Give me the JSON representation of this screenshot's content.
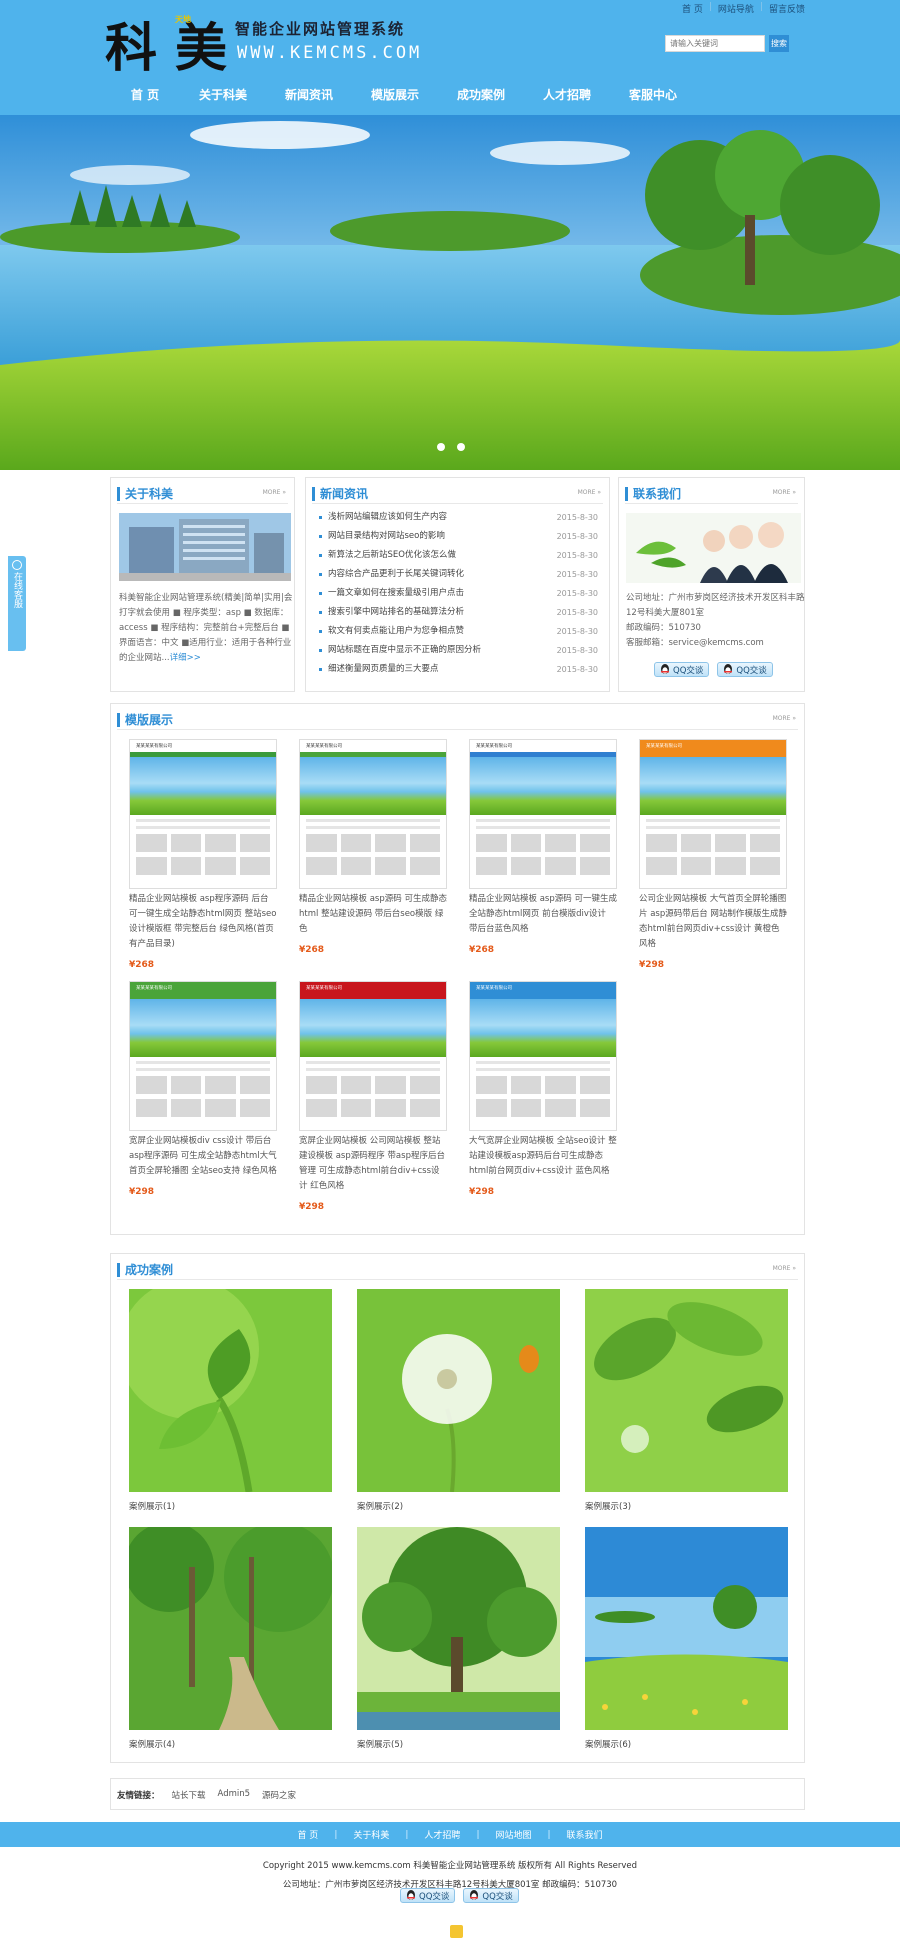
{
  "header": {
    "logo_main": "科美",
    "logo_badge": "天地",
    "logo_tagline": "智能企业网站管理系统",
    "logo_url": "WWW.KEMCMS.COM",
    "top_links": [
      "首 页",
      "网站导航",
      "留言反馈"
    ],
    "search_placeholder": "请输入关键词",
    "search_button": "搜索"
  },
  "nav": [
    "首 页",
    "关于科美",
    "新闻资讯",
    "模版展示",
    "成功案例",
    "人才招聘",
    "客服中心"
  ],
  "about": {
    "title": "关于科美",
    "more": "MORE »",
    "text": "科美智能企业网站管理系统(精美|简单|实用|会打字就会使用 ■ 程序类型：asp ■ 数据库：access ■ 程序结构：完整前台+完整后台 ■ 界面语言：中文 ■适用行业：适用于各种行业的企业网站...",
    "detail": "详细>>"
  },
  "news": {
    "title": "新闻资讯",
    "more": "MORE »",
    "items": [
      {
        "title": "浅析网站编辑应该如何生产内容",
        "date": "2015-8-30"
      },
      {
        "title": "网站目录结构对网站seo的影响",
        "date": "2015-8-30"
      },
      {
        "title": "新算法之后新站SEO优化该怎么做",
        "date": "2015-8-30"
      },
      {
        "title": "内容综合产品更利于长尾关键词转化",
        "date": "2015-8-30"
      },
      {
        "title": "一篇文章如何在搜索量级引用户点击",
        "date": "2015-8-30"
      },
      {
        "title": "搜索引擎中网站排名的基础算法分析",
        "date": "2015-8-30"
      },
      {
        "title": "软文有何卖点能让用户为您争相点赞",
        "date": "2015-8-30"
      },
      {
        "title": "网站标题在百度中显示不正确的原因分析",
        "date": "2015-8-30"
      },
      {
        "title": "细述衡量网页质量的三大要点",
        "date": "2015-8-30"
      }
    ]
  },
  "contact": {
    "title": "联系我们",
    "more": "MORE »",
    "address": "公司地址：广州市萝岗区经济技术开发区科丰路12号科美大厦801室",
    "postcode": "邮政编码：510730",
    "email": "客服邮箱：service@kemcms.com",
    "qq_buttons": [
      "QQ交谈",
      "QQ交谈"
    ]
  },
  "templates": {
    "title": "模版展示",
    "more": "MORE »",
    "shot_header": "某某某某有限公司",
    "items": [
      {
        "desc": "精品企业网站模板 asp程序源码 后台 可一键生成全站静态html网页 整站seo设计模版框 带完整后台 绿色风格(首页有产品目录)",
        "price": "¥268",
        "header": "#ffffff",
        "accent": "#3b9b3b"
      },
      {
        "desc": "精品企业网站模板 asp源码 可生成静态html 整站建设源码 带后台seo模版 绿色",
        "price": "¥268",
        "header": "#ffffff",
        "accent": "#4aa43a"
      },
      {
        "desc": "精品企业网站模板 asp源码 可一键生成全站静态html网页 前台模版div设计 带后台蓝色风格",
        "price": "¥268",
        "header": "#ffffff",
        "accent": "#2f7fd0"
      },
      {
        "desc": "公司企业网站模板 大气首页全屏轮播图片 asp源码带后台 网站制作模版生成静态html前台网页div+css设计 黄橙色风格",
        "price": "¥298",
        "header": "#f08a1c",
        "accent": "#f08a1c"
      },
      {
        "desc": "宽屏企业网站模板div css设计 带后台asp程序源码 可生成全站静态html大气首页全屏轮播图 全站seo支持 绿色风格",
        "price": "¥298",
        "header": "#4aa43a",
        "accent": "#4aa43a"
      },
      {
        "desc": "宽屏企业网站模板 公司网站模板 整站建设模板 asp源码程序 带asp程序后台管理 可生成静态html前台div+css设计 红色风格",
        "price": "¥298",
        "header": "#c8161d",
        "accent": "#c8161d"
      },
      {
        "desc": "大气宽屏企业网站模板 全站seo设计 整站建设模板asp源码后台可生成静态html前台网页div+css设计 蓝色风格",
        "price": "¥298",
        "header": "#2f8ed5",
        "accent": "#2f8ed5"
      }
    ]
  },
  "cases": {
    "title": "成功案例",
    "more": "MORE »",
    "items": [
      "案例展示(1)",
      "案例展示(2)",
      "案例展示(3)",
      "案例展示(4)",
      "案例展示(5)",
      "案例展示(6)"
    ]
  },
  "links": {
    "label": "友情链接：",
    "items": [
      "站长下载",
      "Admin5",
      "源码之家"
    ]
  },
  "footer": {
    "nav": [
      "首 页",
      "关于科美",
      "人才招聘",
      "网站地图",
      "联系我们"
    ],
    "copyright": "Copyright 2015 www.kemcms.com 科美智能企业网站管理系统 版权所有 All Rights Reserved",
    "address": "公司地址：广州市萝岗区经济技术开发区科丰路12号科美大厦801室 邮政编码：510730",
    "qq_buttons": [
      "QQ交谈",
      "QQ交谈"
    ]
  },
  "sidetab": {
    "label": "在线客服"
  },
  "colors": {
    "brand_blue": "#4fb3ec",
    "title_blue": "#2f8ed5",
    "price_orange": "#e45a1a"
  }
}
